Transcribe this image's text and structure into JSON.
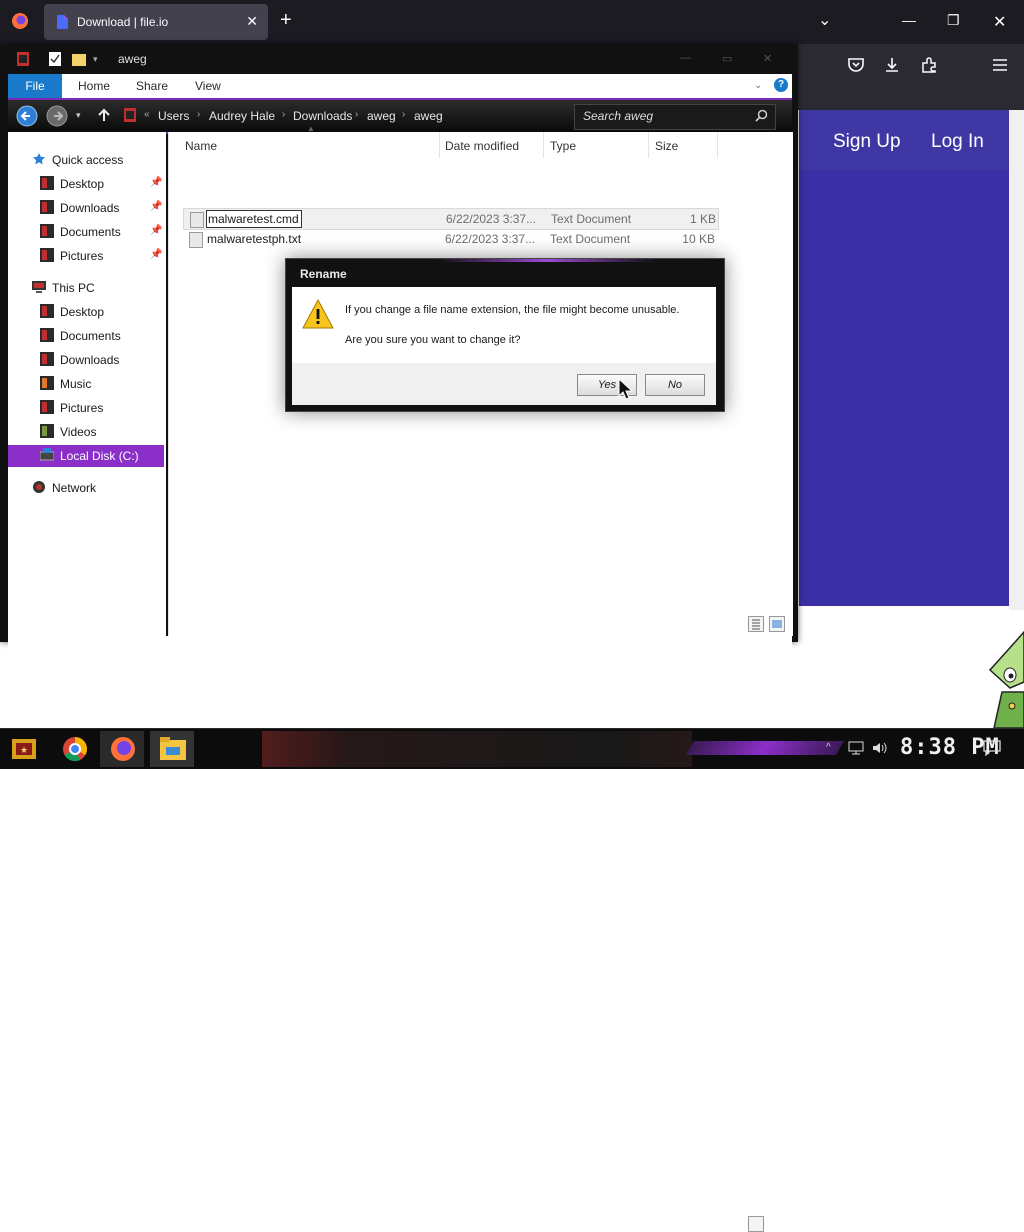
{
  "browser": {
    "tab_title": "Download | file.io",
    "tab_close": "✕",
    "new_tab": "+",
    "window_controls": {
      "list": "⌄",
      "minimize": "—",
      "restore": "❐",
      "close": "✕"
    },
    "toolbar_icons": [
      "pocket-icon",
      "download-icon",
      "extensions-icon",
      "menu-icon"
    ]
  },
  "web": {
    "signup_label": "Sign Up",
    "login_label": "Log In",
    "colors": {
      "header": "#3f37a3",
      "hero": "#3b2fa6"
    }
  },
  "explorer": {
    "title": "aweg",
    "ribbon": {
      "file": "File",
      "home": "Home",
      "share": "Share",
      "view": "View",
      "help": "?"
    },
    "breadcrumb": [
      "Users",
      "Audrey Hale",
      "Downloads",
      "aweg",
      "aweg"
    ],
    "search_placeholder": "Search aweg",
    "nav": {
      "quick_access": "Quick access",
      "qa_items": [
        "Desktop",
        "Downloads",
        "Documents",
        "Pictures"
      ],
      "this_pc": "This PC",
      "pc_items": [
        "Desktop",
        "Documents",
        "Downloads",
        "Music",
        "Pictures",
        "Videos"
      ],
      "local_disk": "Local Disk (C:)",
      "network": "Network"
    },
    "columns": {
      "name": "Name",
      "date": "Date modified",
      "type": "Type",
      "size": "Size"
    },
    "files": [
      {
        "name": "malwaretest.cmd",
        "date": "6/22/2023 3:37...",
        "type": "Text Document",
        "size": "1 KB",
        "editing": true
      },
      {
        "name": "malwaretestph.txt",
        "date": "6/22/2023 3:37...",
        "type": "Text Document",
        "size": "10 KB",
        "editing": false
      }
    ],
    "accent": "#8b2fc9"
  },
  "dialog": {
    "title": "Rename",
    "line1": "If you change a file name extension, the file might become unusable.",
    "line2": "Are you sure you want to change it?",
    "yes_label": "Yes",
    "no_label": "No"
  },
  "taskbar": {
    "clock": "8:38 PM",
    "apps": [
      "start-icon",
      "chrome-icon",
      "firefox-icon",
      "file-explorer-icon"
    ]
  }
}
